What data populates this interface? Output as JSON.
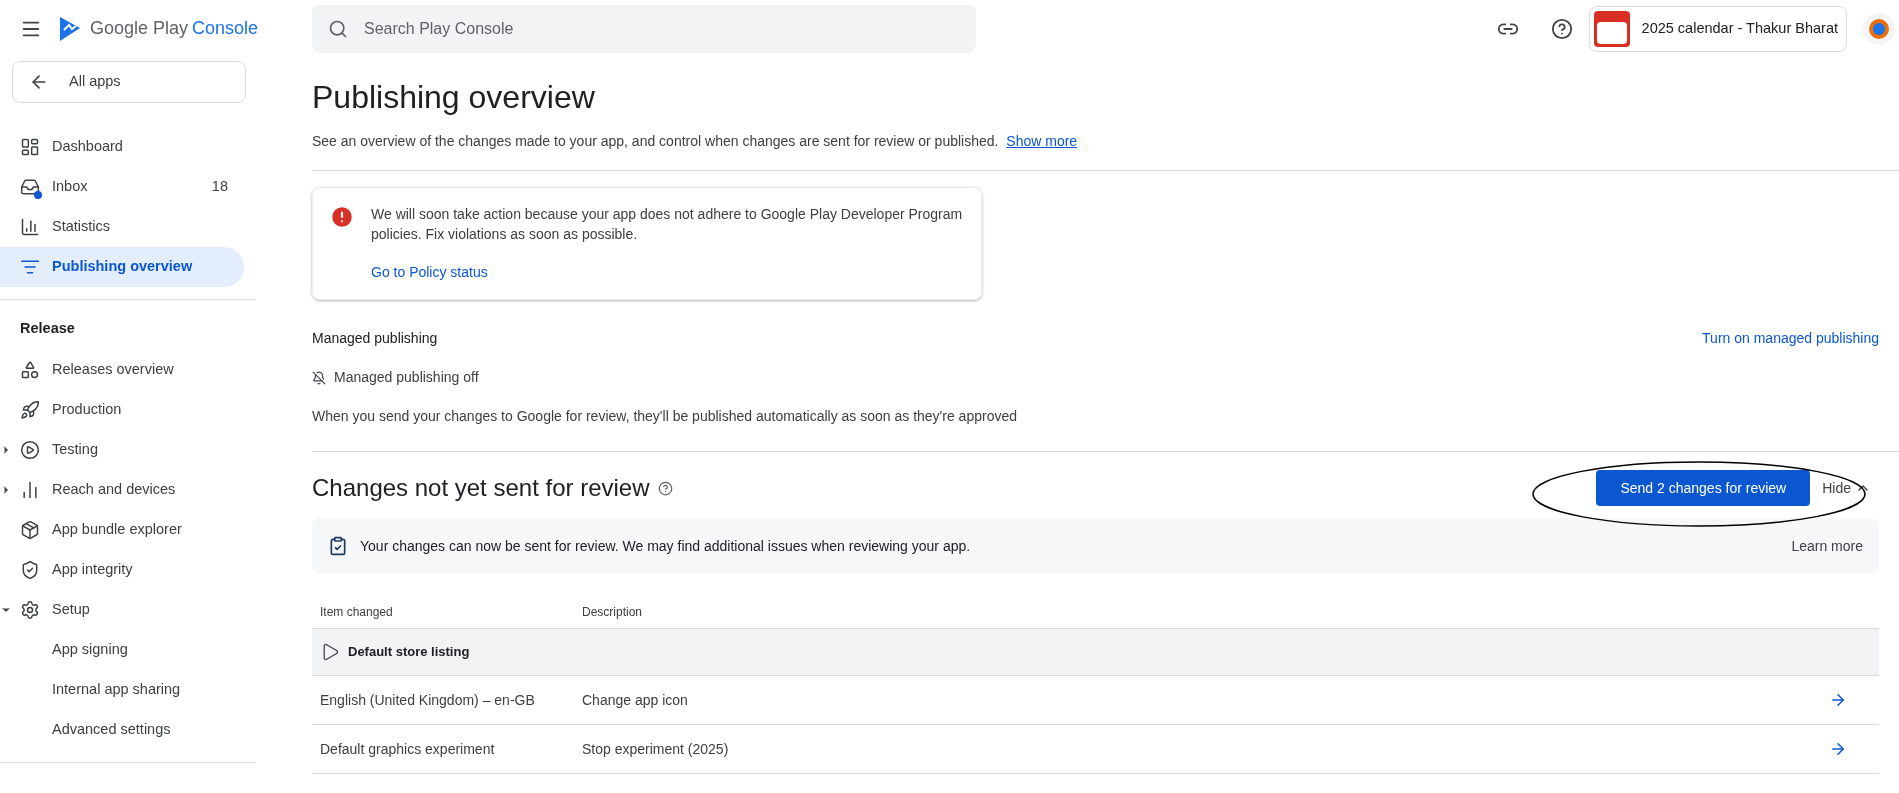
{
  "header": {
    "logo_text": "Google Play",
    "logo_accent": "Console",
    "search_placeholder": "Search Play Console",
    "app_name": "2025 calendar - Thakur Bharat"
  },
  "sidebar": {
    "back": "All apps",
    "items": [
      {
        "label": "Dashboard",
        "selected": false
      },
      {
        "label": "Inbox",
        "count": "18",
        "selected": false
      },
      {
        "label": "Statistics",
        "selected": false
      },
      {
        "label": "Publishing overview",
        "selected": true
      }
    ],
    "section": "Release",
    "release_items": [
      {
        "label": "Releases overview",
        "selected": false
      },
      {
        "label": "Production",
        "selected": false
      },
      {
        "label": "Testing",
        "expanded": false,
        "selected": false
      },
      {
        "label": "Reach and devices",
        "expanded": false,
        "selected": false
      },
      {
        "label": "App bundle explorer",
        "selected": false
      },
      {
        "label": "App integrity",
        "selected": false
      },
      {
        "label": "Setup",
        "expanded": true,
        "selected": false,
        "children": [
          {
            "label": "App signing",
            "selected": false
          },
          {
            "label": "Internal app sharing",
            "selected": false
          },
          {
            "label": "Advanced settings",
            "selected": false
          }
        ]
      }
    ]
  },
  "page": {
    "title": "Publishing overview",
    "subtitle": "See an overview of the changes made to your app, and control when changes are sent for review or published.",
    "show_more": "Show more",
    "alert": {
      "text": "We will soon take action because your app does not adhere to Google Play Developer Program policies. Fix violations as soon as possible.",
      "link": "Go to Policy status"
    },
    "managed": {
      "title": "Managed publishing",
      "action": "Turn on managed publishing",
      "status": "Managed publishing off",
      "description": "When you send your changes to Google for review, they'll be published automatically as soon as they're approved"
    },
    "changes": {
      "title": "Changes not yet sent for review",
      "send_button": "Send 2 changes for review",
      "hide": "Hide",
      "expanded": true,
      "banner": {
        "text": "Your changes can now be sent for review. We may find additional issues when reviewing your app.",
        "link": "Learn more"
      },
      "columns": [
        "Item changed",
        "Description"
      ],
      "group": "Default store listing",
      "rows": [
        {
          "item": "English (United Kingdom) – en-GB",
          "description": "Change app icon"
        },
        {
          "item": "Default graphics experiment",
          "description": "Stop experiment (2025)"
        }
      ]
    }
  }
}
